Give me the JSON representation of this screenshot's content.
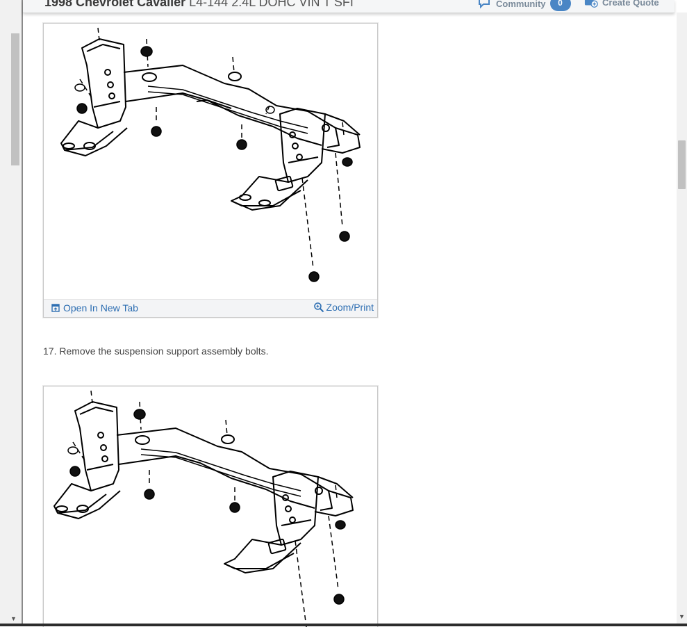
{
  "header": {
    "title_bold": "1998 Chevrolet Cavalier",
    "title_sub": "L4-144 2.4L DOHC VIN T SFI",
    "community_label": "Community",
    "community_count": "0",
    "quote_label": "Create Quote"
  },
  "figure1": {
    "open_tab_label": "Open In New Tab",
    "zoom_label": "Zoom/Print"
  },
  "step": {
    "text": "17. Remove the suspension support assembly bolts."
  },
  "icons": {
    "open_tab": "open-tab-icon",
    "zoom": "magnifier-icon",
    "community": "comment-icon",
    "quote": "add-quote-icon"
  },
  "colors": {
    "link": "#2d6eb2",
    "badge": "#4a86c5",
    "header_bg": "#f5f6f7"
  }
}
